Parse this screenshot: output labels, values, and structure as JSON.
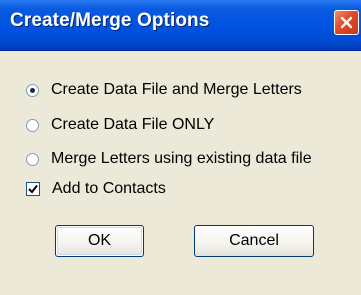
{
  "window": {
    "title": "Create/Merge Options",
    "close_icon": "close-icon"
  },
  "options": [
    {
      "label": "Create Data File and Merge Letters",
      "selected": true
    },
    {
      "label": "Create Data File ONLY",
      "selected": false
    },
    {
      "label": "Merge Letters using existing data file",
      "selected": false
    }
  ],
  "add_to_contacts": {
    "label": "Add to Contacts",
    "checked": true
  },
  "buttons": {
    "ok_label": "OK",
    "cancel_label": "Cancel"
  },
  "colors": {
    "titlebar": "#0053e1",
    "dialog_bg": "#ece9d8",
    "close_button": "#e0492a"
  }
}
